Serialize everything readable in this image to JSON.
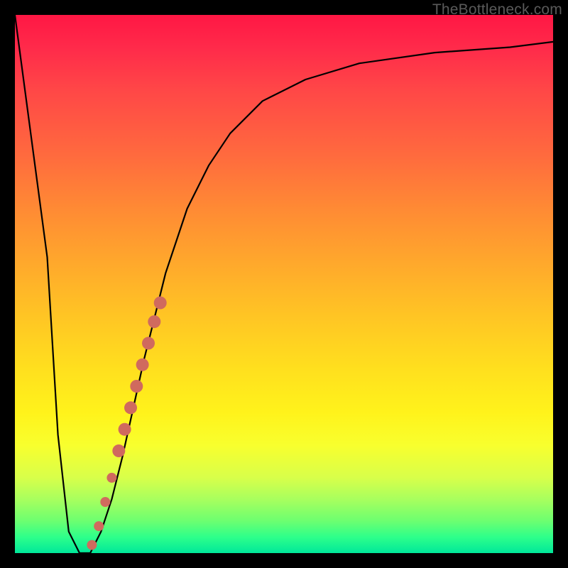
{
  "watermark": "TheBottleneck.com",
  "chart_data": {
    "type": "line",
    "title": "",
    "xlabel": "",
    "ylabel": "",
    "xlim": [
      0,
      100
    ],
    "ylim": [
      0,
      100
    ],
    "series": [
      {
        "name": "bottleneck-curve",
        "x": [
          0,
          6,
          8,
          10,
          12,
          13,
          14,
          16,
          18,
          20,
          22,
          24,
          26,
          28,
          32,
          36,
          40,
          46,
          54,
          64,
          78,
          92,
          100
        ],
        "y": [
          100,
          55,
          22,
          4,
          0,
          0,
          0,
          4,
          10,
          18,
          27,
          36,
          44,
          52,
          64,
          72,
          78,
          84,
          88,
          91,
          93,
          94,
          95
        ]
      }
    ],
    "highlight_points": {
      "name": "highlight-dots",
      "color": "#d06a5e",
      "points": [
        {
          "x": 14.3,
          "y": 1.5,
          "r": 7
        },
        {
          "x": 15.6,
          "y": 5.0,
          "r": 7
        },
        {
          "x": 16.8,
          "y": 9.5,
          "r": 7
        },
        {
          "x": 18.0,
          "y": 14.0,
          "r": 7
        },
        {
          "x": 19.3,
          "y": 19.0,
          "r": 9
        },
        {
          "x": 20.4,
          "y": 23.0,
          "r": 9
        },
        {
          "x": 21.5,
          "y": 27.0,
          "r": 9
        },
        {
          "x": 22.6,
          "y": 31.0,
          "r": 9
        },
        {
          "x": 23.7,
          "y": 35.0,
          "r": 9
        },
        {
          "x": 24.8,
          "y": 39.0,
          "r": 9
        },
        {
          "x": 25.9,
          "y": 43.0,
          "r": 9
        },
        {
          "x": 27.0,
          "y": 46.5,
          "r": 9
        }
      ]
    }
  }
}
